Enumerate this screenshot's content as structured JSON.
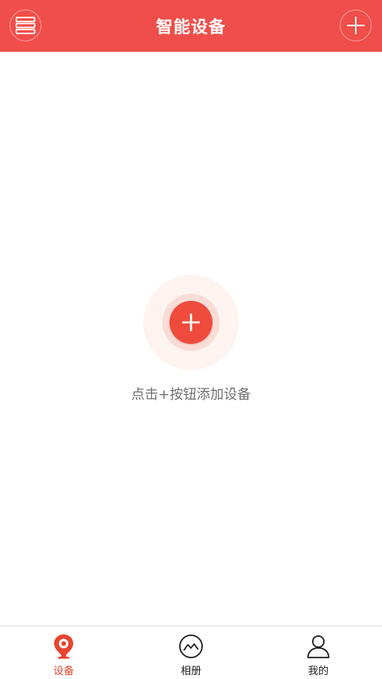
{
  "header": {
    "title": "智能设备",
    "left_icon": "menu-list-icon",
    "right_icon": "plus-icon"
  },
  "empty_state": {
    "hint": "点击+按钮添加设备",
    "add_icon": "plus-icon"
  },
  "bottom_nav": {
    "items": [
      {
        "label": "设备",
        "icon": "camera-pin-icon",
        "active": true
      },
      {
        "label": "相册",
        "icon": "album-mountain-icon",
        "active": false
      },
      {
        "label": "我的",
        "icon": "user-profile-icon",
        "active": false
      }
    ]
  },
  "colors": {
    "brand": "#F04E4A",
    "accent": "#EE4B3C",
    "active_nav": "#E8442F"
  }
}
